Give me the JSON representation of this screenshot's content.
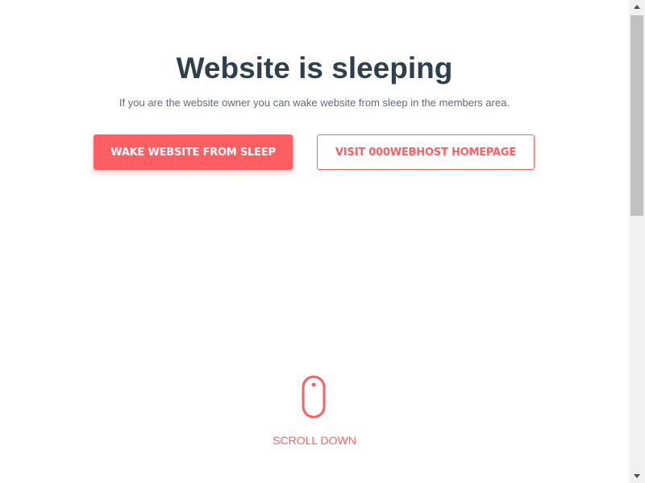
{
  "hero": {
    "title": "Website is sleeping",
    "subtitle": "If you are the website owner you can wake website from sleep in the members area."
  },
  "actions": {
    "wake_label": "WAKE WEBSITE FROM SLEEP",
    "visit_label": "VISIT 000WEBHOST HOMEPAGE"
  },
  "scroll_hint": {
    "label": "SCROLL DOWN",
    "icon": "mouse-icon"
  },
  "colors": {
    "accent": "#ff5f63",
    "title": "#2f3f4c",
    "subtitle": "#5f6b75"
  },
  "scrollbar": {
    "position": 0
  }
}
